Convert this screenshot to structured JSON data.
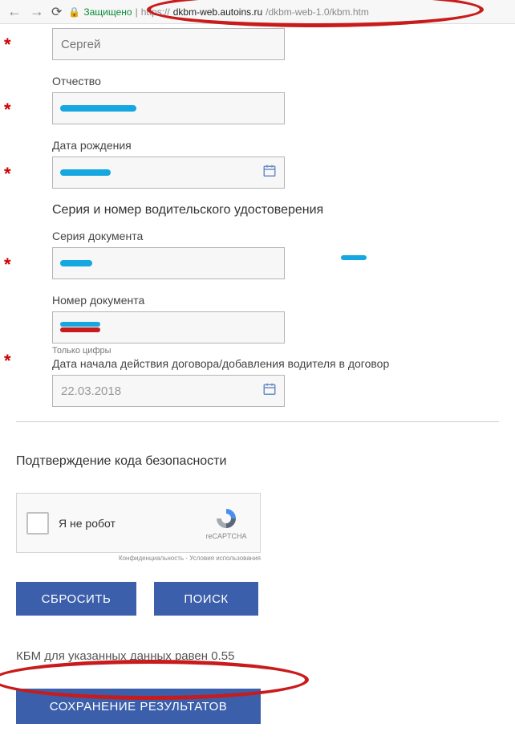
{
  "browser": {
    "secure_label": "Защищено",
    "url_scheme": "https://",
    "url_host": "dkbm-web.autoins.ru",
    "url_path": "/dkbm-web-1.0/kbm.htm"
  },
  "fields": {
    "name_placeholder": "Сергей",
    "patronymic_label": "Отчество",
    "dob_label": "Дата рождения",
    "license_section": "Серия и номер водительского удостоверения",
    "doc_series_label": "Серия документа",
    "doc_number_label": "Номер документа",
    "digits_only": "Только цифры",
    "contract_date_label": "Дата начала действия договора/добавления водителя в договор",
    "contract_date_value": "22.03.2018"
  },
  "captcha": {
    "section_title": "Подтверждение кода безопасности",
    "checkbox_label": "Я не робот",
    "brand": "reCAPTCHA",
    "terms": "Конфиденциальность - Условия использования"
  },
  "buttons": {
    "reset": "СБРОСИТЬ",
    "search": "ПОИСК",
    "save": "СОХРАНЕНИЕ РЕЗУЛЬТАТОВ"
  },
  "result": "КБМ для указанных данных равен 0.55"
}
